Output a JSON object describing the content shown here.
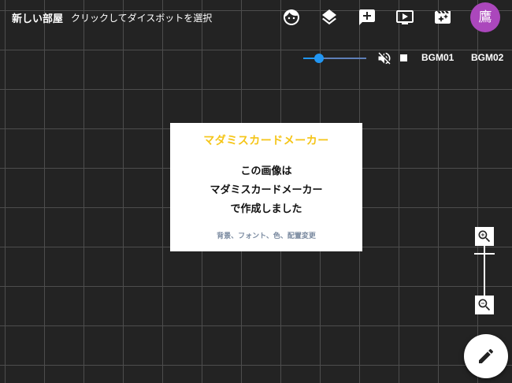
{
  "header": {
    "room_title": "新しい部屋",
    "hint": "クリックしてダイスボットを選択",
    "icons": {
      "character": "face-icon",
      "layers": "layers-icon",
      "add_comment": "add-comment-icon",
      "screen": "screen-play-icon",
      "scene": "movie-edit-icon"
    },
    "avatar_initial": "鷹",
    "avatar_color": "#ab47bc"
  },
  "audio": {
    "volume": 0.25,
    "mute_icon": "volume-off-icon",
    "stop_icon": "stop-icon",
    "bgm_tracks": [
      "BGM01",
      "BGM02"
    ],
    "accent_color": "#2196f3"
  },
  "card": {
    "title": "マダミスカードメーカー",
    "body_lines": [
      "この画像は",
      "マダミスカードメーカー",
      "で作成しました"
    ],
    "footer": "背景、フォント、色、配置変更",
    "title_color": "#f5c518"
  },
  "zoom": {
    "zoom_in_icon": "zoom-in-icon",
    "zoom_out_icon": "zoom-out-icon",
    "level": 0.5
  },
  "fab": {
    "icon": "pencil-icon"
  }
}
